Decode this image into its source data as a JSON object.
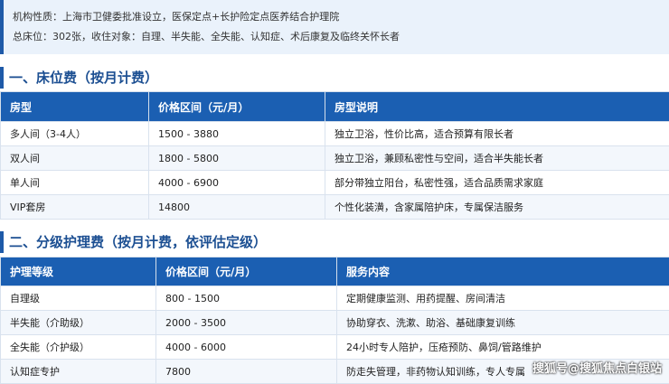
{
  "info": {
    "line1": "机构性质：上海市卫健委批准设立，医保定点+长护险定点医养结合护理院",
    "line2": "总床位：302张，收住对象：自理、半失能、全失能、认知症、术后康复及临终关怀长者"
  },
  "section1": {
    "title": "一、床位费（按月计费）",
    "headers": [
      "房型",
      "价格区间（元/月）",
      "房型说明"
    ],
    "rows": [
      [
        "多人间（3-4人）",
        "1500 - 3880",
        "独立卫浴，性价比高，适合预算有限长者"
      ],
      [
        "双人间",
        "1800 - 5800",
        "独立卫浴，兼顾私密性与空间，适合半失能长者"
      ],
      [
        "单人间",
        "4000 - 6900",
        "部分带独立阳台，私密性强，适合品质需求家庭"
      ],
      [
        "VIP套房",
        "14800",
        "个性化装潢，含家属陪护床，专属保洁服务"
      ]
    ]
  },
  "section2": {
    "title": "二、分级护理费（按月计费，依评估定级）",
    "headers": [
      "护理等级",
      "价格区间（元/月）",
      "服务内容"
    ],
    "rows": [
      [
        "自理级",
        "800 - 1500",
        "定期健康监测、用药提醒、房间清洁"
      ],
      [
        "半失能（介助级）",
        "2000 - 3500",
        "协助穿衣、洗漱、助浴、基础康复训练"
      ],
      [
        "全失能（介护级）",
        "4000 - 6000",
        "24小时专人陪护，压疮预防、鼻饲/管路维护"
      ],
      [
        "认知症专护",
        "7800",
        "防走失管理，非药物认知训练，专人专属"
      ]
    ]
  },
  "watermark": "搜狐号@搜狐焦点白银站"
}
